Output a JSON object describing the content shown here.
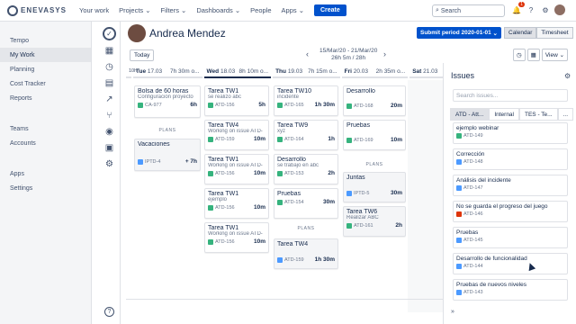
{
  "topbar": {
    "brand": "ENEVASYS",
    "nav": [
      "Your work",
      "Projects ⌄",
      "Filters ⌄",
      "Dashboards ⌄",
      "People",
      "Apps ⌄"
    ],
    "create": "Create",
    "search_placeholder": "Search",
    "notif_count": "1"
  },
  "leftnav": {
    "section1": [
      "Tempo",
      "My Work",
      "Planning",
      "Cost Tracker",
      "Reports"
    ],
    "section2": [
      "Teams",
      "Accounts"
    ],
    "section3": [
      "Apps",
      "Settings"
    ]
  },
  "header": {
    "user_name": "Andrea Mendez",
    "submit": "Submit period 2020-01-01",
    "views": [
      "Calendar",
      "Timesheet"
    ]
  },
  "toolbar": {
    "today": "Today",
    "period_line1": "15/Mar/20 - 21/Mar/20",
    "period_line2": "26h 5m / 28h",
    "view": "View ⌄"
  },
  "days": [
    {
      "label": "Tue",
      "date": "17.03",
      "logged": "7h 30m o..."
    },
    {
      "label": "Wed",
      "date": "18.03",
      "logged": "8h 10m o..."
    },
    {
      "label": "Thu",
      "date": "19.03",
      "logged": "7h 15m o..."
    },
    {
      "label": "Fri",
      "date": "20.03",
      "logged": "2h 35m o..."
    },
    {
      "label": "Sat",
      "date": "21.03",
      "logged": ""
    }
  ],
  "col_stub": "10h",
  "plans_label": "PLANS",
  "tue": {
    "cards": [
      {
        "t": "Bolsa de 60 horas",
        "d": "Configuración proyecto",
        "k": "CA-977",
        "h": "6h"
      }
    ],
    "plans": [
      {
        "t": "Vacaciones",
        "k": "IPTD-4",
        "h": "+ 7h"
      }
    ]
  },
  "wed": {
    "cards": [
      {
        "t": "Tarea TW1",
        "d": "se realizo abc",
        "k": "ATD-156",
        "h": "5h"
      },
      {
        "t": "Tarea TW4",
        "d": "Working on issue ATD-",
        "k": "ATD-159",
        "h": "10m"
      },
      {
        "t": "Tarea TW1",
        "d": "Working on issue ATD-",
        "k": "ATD-156",
        "h": "10m"
      },
      {
        "t": "Tarea TW1",
        "d": "ejemplo",
        "k": "ATD-156",
        "h": "10m"
      },
      {
        "t": "Tarea TW1",
        "d": "Working on issue ATD-",
        "k": "ATD-156",
        "h": "10m"
      }
    ]
  },
  "thu": {
    "cards": [
      {
        "t": "Tarea TW10",
        "d": "incidente",
        "k": "ATD-165",
        "h": "1h 30m"
      },
      {
        "t": "Tarea TW9",
        "d": "xyz",
        "k": "ATD-164",
        "h": "1h"
      },
      {
        "t": "Desarrollo",
        "d": "se trabajo en abc",
        "k": "ATD-153",
        "h": "2h"
      },
      {
        "t": "Pruebas",
        "d": "",
        "k": "ATD-154",
        "h": "30m"
      }
    ],
    "plans": [
      {
        "t": "Tarea TW4",
        "k": "ATD-159",
        "h": "1h 30m"
      }
    ]
  },
  "fri": {
    "cards": [
      {
        "t": "Desarrollo",
        "d": "",
        "k": "ATD-168",
        "h": "20m"
      },
      {
        "t": "Pruebas",
        "d": "",
        "k": "ATD-169",
        "h": "10m"
      }
    ],
    "plans": [
      {
        "t": "Juntas",
        "k": "IPTD-5",
        "h": "30m"
      },
      {
        "t": "Tarea TW6",
        "d": "Realizar ABC",
        "k": "ATD-161",
        "h": "2h"
      }
    ]
  },
  "issues": {
    "title": "Issues",
    "search_placeholder": "Search issues...",
    "tabs": [
      "ATD - Att...",
      "Internal",
      "TES - Te...",
      "..."
    ],
    "items": [
      {
        "n": "ejemplo webinar",
        "k": "ATD-149",
        "c": "#36b37e"
      },
      {
        "n": "Corrección",
        "k": "ATD-148",
        "c": "#4c9aff"
      },
      {
        "n": "Análisis del incidente",
        "k": "ATD-147",
        "c": "#4c9aff"
      },
      {
        "n": "No se guarda el progreso del juego",
        "k": "ATD-146",
        "c": "#de350b"
      },
      {
        "n": "Pruebas",
        "k": "ATD-145",
        "c": "#4c9aff"
      },
      {
        "n": "Desarrollo de funcionalidad",
        "k": "ATD-144",
        "c": "#4c9aff"
      },
      {
        "n": "Pruebas de nuevos niveles",
        "k": "ATD-143",
        "c": "#4c9aff"
      }
    ]
  },
  "misc": {
    "help": "?",
    "collapse": "»"
  }
}
